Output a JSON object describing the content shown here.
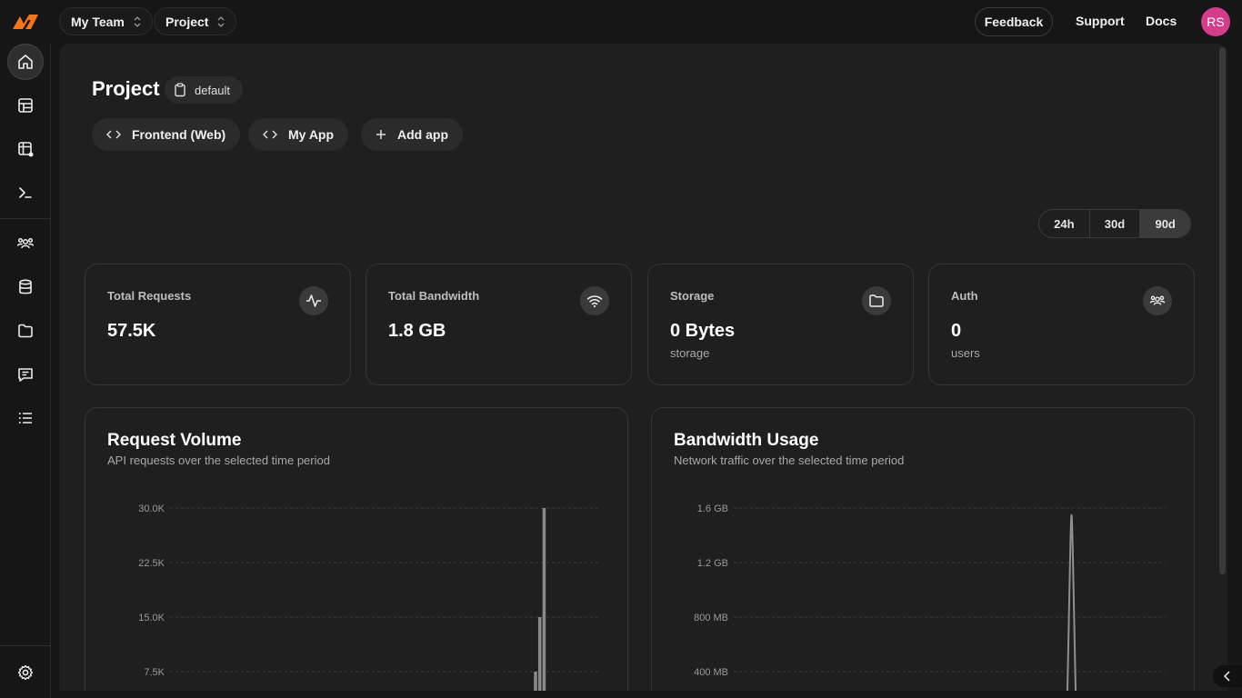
{
  "topbar": {
    "team": "My Team",
    "project": "Project",
    "feedback": "Feedback",
    "support": "Support",
    "docs": "Docs",
    "avatar_initials": "RS",
    "avatar_color": "#d43d8c",
    "logo_color": "#f5761a"
  },
  "sidebar": {
    "items": [
      {
        "name": "home-icon",
        "active": true
      },
      {
        "name": "layout-icon"
      },
      {
        "name": "table-edit-icon"
      },
      {
        "name": "terminal-icon"
      },
      {
        "name": "users-icon"
      },
      {
        "name": "database-icon"
      },
      {
        "name": "folder-icon"
      },
      {
        "name": "message-icon"
      },
      {
        "name": "list-icon"
      }
    ],
    "footer_icon": "gear-icon"
  },
  "project": {
    "title": "Project",
    "environment": "default",
    "apps": [
      "Frontend (Web)",
      "My App"
    ],
    "add_app": "Add app"
  },
  "time_range": {
    "options": [
      "24h",
      "30d",
      "90d"
    ],
    "selected": "90d"
  },
  "stats": [
    {
      "label": "Total Requests",
      "value": "57.5K",
      "sub": "",
      "icon": "activity-icon"
    },
    {
      "label": "Total Bandwidth",
      "value": "1.8 GB",
      "sub": "",
      "icon": "wifi-icon"
    },
    {
      "label": "Storage",
      "value": "0 Bytes",
      "sub": "storage",
      "icon": "folder-icon"
    },
    {
      "label": "Auth",
      "value": "0",
      "sub": "users",
      "icon": "users-icon"
    }
  ],
  "charts": {
    "requests": {
      "title": "Request Volume",
      "subtitle": "API requests over the selected time period"
    },
    "bandwidth": {
      "title": "Bandwidth Usage",
      "subtitle": "Network traffic over the selected time period"
    }
  },
  "chart_data": [
    {
      "type": "bar",
      "title": "Request Volume",
      "ylabel": "",
      "y_ticks": [
        "30.0K",
        "22.5K",
        "15.0K",
        "7.5K"
      ],
      "ylim": [
        0,
        30000
      ],
      "bars": [
        {
          "rel_x": 0.92,
          "value": 7500
        },
        {
          "rel_x": 0.93,
          "value": 15000
        },
        {
          "rel_x": 0.94,
          "value": 30000
        }
      ],
      "grid": true
    },
    {
      "type": "line",
      "title": "Bandwidth Usage",
      "ylabel": "",
      "y_ticks": [
        "1.6 GB",
        "1.2 GB",
        "800 MB",
        "400 MB"
      ],
      "ylim": [
        0,
        1.6
      ],
      "peak": {
        "rel_x": 0.82,
        "value": 1.55
      },
      "grid": true
    }
  ]
}
